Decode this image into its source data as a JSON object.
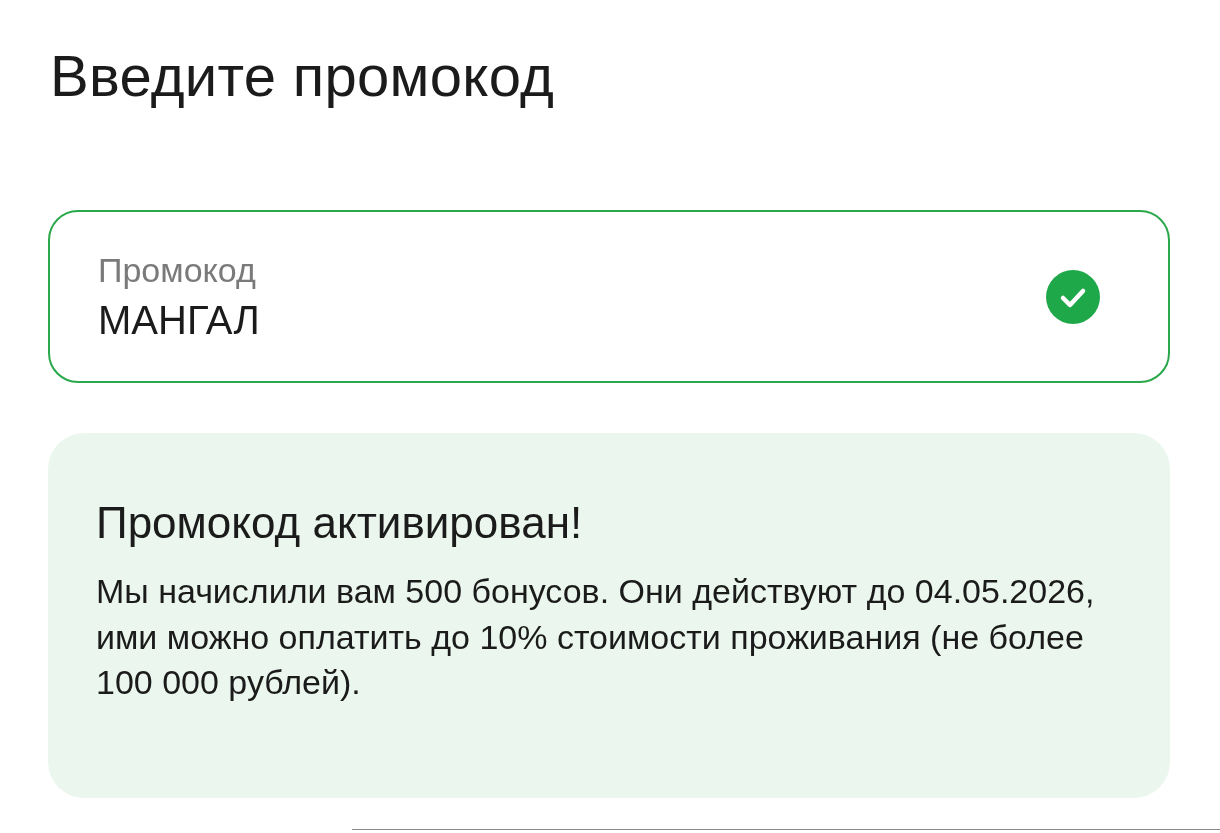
{
  "title": "Введите промокод",
  "promo_field": {
    "label": "Промокод",
    "value": "МАНГАЛ",
    "valid": true
  },
  "message": {
    "heading": "Промокод активирован!",
    "body": "Мы начислили вам 500 бонусов. Они действуют до 04.05.2026, ими можно оплатить до 10% стоимости проживания (не более 100 000 рублей)."
  }
}
